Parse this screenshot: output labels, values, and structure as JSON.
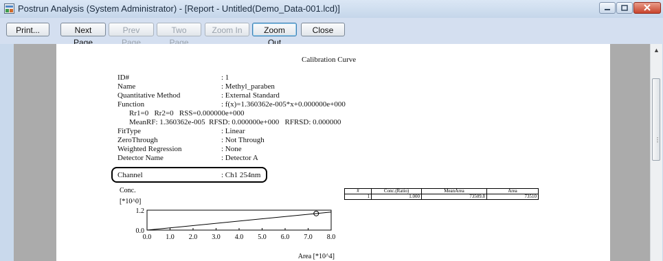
{
  "window": {
    "title": "Postrun Analysis (System Administrator) - [Report - Untitled(Demo_Data-001.lcd)]"
  },
  "toolbar": {
    "print": "Print...",
    "next_page": "Next Page",
    "prev_page": "Prev Page",
    "two_page": "Two Page",
    "zoom_in": "Zoom In",
    "zoom_out": "Zoom Out",
    "close": "Close"
  },
  "report": {
    "title": "Calibration Curve",
    "fields": [
      {
        "label": "ID#",
        "value": ": 1"
      },
      {
        "label": "Name",
        "value": ": Methyl_paraben"
      },
      {
        "label": "Quantitative Method",
        "value": ": External Standard"
      },
      {
        "label": "Function",
        "value": ": f(x)=1.360362e-005*x+0.000000e+000"
      },
      {
        "label": "FitType",
        "value": ": Linear"
      },
      {
        "label": "ZeroThrough",
        "value": ": Not Through"
      },
      {
        "label": "Weighted Regression",
        "value": ": None"
      },
      {
        "label": "Detector Name",
        "value": ": Detector A"
      },
      {
        "label": "Channel",
        "value": ": Ch1 254nm"
      }
    ],
    "stats_line1": "Rr1=0   Rr2=0   RSS=0.000000e+000",
    "stats_line2": "MeanRF: 1.360362e-005  RFSD: 0.000000e+000   RFRSD: 0.000000"
  },
  "table": {
    "headers": [
      "#",
      "Conc.(Ratio)",
      "MeanArea",
      "Area"
    ],
    "rows": [
      [
        "1",
        "1.000",
        "73509.8",
        "73510"
      ]
    ]
  },
  "chart_data": {
    "type": "line",
    "ylabel": "Conc.",
    "y_multiplier": "[*10^0]",
    "xlabel": "Area [*10^4]",
    "xlim": [
      0.0,
      8.0
    ],
    "ylim": [
      0.0,
      1.2
    ],
    "x_ticks": [
      "0.0",
      "1.0",
      "2.0",
      "3.0",
      "4.0",
      "5.0",
      "6.0",
      "7.0",
      "8.0"
    ],
    "y_ticks": [
      "0.0",
      "1.2"
    ],
    "line": {
      "x": [
        0.0,
        8.0
      ],
      "y": [
        0.0,
        1.088
      ]
    },
    "points": [
      {
        "x": 7.35098,
        "y": 1.0
      }
    ]
  }
}
